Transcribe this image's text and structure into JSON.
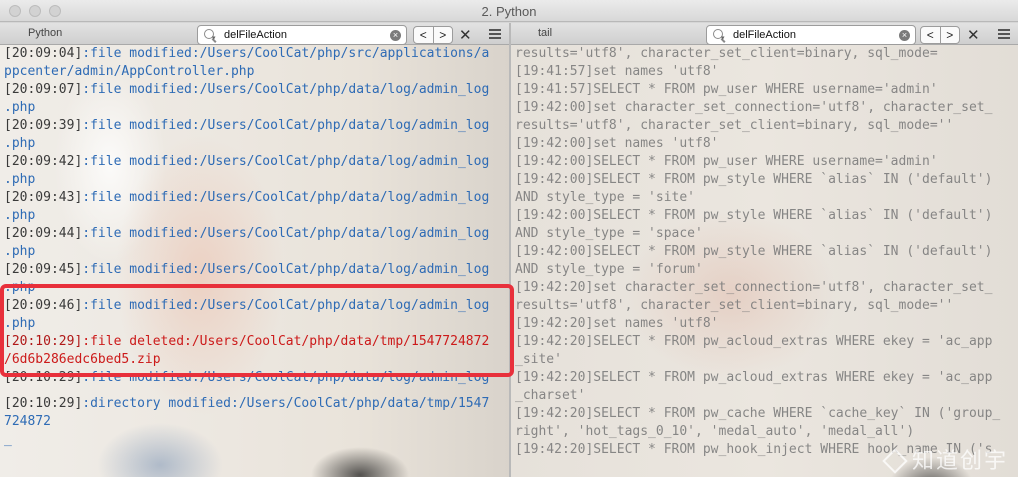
{
  "window": {
    "title": "2. Python"
  },
  "left_pane": {
    "tab_label": "Python",
    "find": {
      "value": "delFileAction",
      "clear": "×",
      "prev": "<",
      "next": ">",
      "close": "✕"
    },
    "lines": [
      {
        "ts": "[20:09:04]",
        "text": ":file modified:/Users/CoolCat/php/src/applications/a"
      },
      {
        "ts": "",
        "text": "ppcenter/admin/AppController.php"
      },
      {
        "ts": "[20:09:07]",
        "text": ":file modified:/Users/CoolCat/php/data/log/admin_log"
      },
      {
        "ts": "",
        "text": ".php"
      },
      {
        "ts": "[20:09:39]",
        "text": ":file modified:/Users/CoolCat/php/data/log/admin_log"
      },
      {
        "ts": "",
        "text": ".php"
      },
      {
        "ts": "[20:09:42]",
        "text": ":file modified:/Users/CoolCat/php/data/log/admin_log"
      },
      {
        "ts": "",
        "text": ".php"
      },
      {
        "ts": "[20:09:43]",
        "text": ":file modified:/Users/CoolCat/php/data/log/admin_log"
      },
      {
        "ts": "",
        "text": ".php"
      },
      {
        "ts": "[20:09:44]",
        "text": ":file modified:/Users/CoolCat/php/data/log/admin_log"
      },
      {
        "ts": "",
        "text": ".php"
      },
      {
        "ts": "[20:09:45]",
        "text": ":file modified:/Users/CoolCat/php/data/log/admin_log"
      },
      {
        "ts": "",
        "text": ".php"
      },
      {
        "ts": "[20:09:46]",
        "text": ":file modified:/Users/CoolCat/php/data/log/admin_log"
      },
      {
        "ts": "",
        "text": ".php"
      },
      {
        "ts": "[20:10:29]",
        "text": ":file deleted:/Users/CoolCat/php/data/tmp/1547724872",
        "red": true
      },
      {
        "ts": "",
        "text": "/6d6b286edc6bed5.zip",
        "red": true
      },
      {
        "ts": "[20:10:29]",
        "text": ":file modified:/Users/CoolCat/php/data/log/admin_log"
      },
      {
        "gap": true
      },
      {
        "ts": "[20:10:29]",
        "text": ":directory modified:/Users/CoolCat/php/data/tmp/1547"
      },
      {
        "ts": "",
        "text": "724872"
      },
      {
        "ts": "",
        "text": "_"
      }
    ]
  },
  "right_pane": {
    "tab_label": "tail",
    "find": {
      "value": "delFileAction",
      "clear": "×",
      "prev": "<",
      "next": ">",
      "close": "✕"
    },
    "lines": [
      "results='utf8', character_set_client=binary, sql_mode=",
      "[19:41:57]set names 'utf8'",
      "[19:41:57]SELECT * FROM pw_user WHERE username='admin'",
      "[19:42:00]set character_set_connection='utf8', character_set_",
      "results='utf8', character_set_client=binary, sql_mode=''",
      "[19:42:00]set names 'utf8'",
      "[19:42:00]SELECT * FROM pw_user WHERE username='admin'",
      "[19:42:00]SELECT * FROM pw_style WHERE `alias` IN ('default')",
      "AND style_type = 'site'",
      "[19:42:00]SELECT * FROM pw_style WHERE `alias` IN ('default')",
      "AND style_type = 'space'",
      "[19:42:00]SELECT * FROM pw_style WHERE `alias` IN ('default')",
      "AND style_type = 'forum'",
      "[19:42:20]set character_set_connection='utf8', character_set_",
      "results='utf8', character_set_client=binary, sql_mode=''",
      "[19:42:20]set names 'utf8'",
      "[19:42:20]SELECT * FROM pw_acloud_extras WHERE ekey = 'ac_app",
      "_site'",
      "[19:42:20]SELECT * FROM pw_acloud_extras WHERE ekey = 'ac_app",
      "_charset'",
      "[19:42:20]SELECT * FROM pw_cache WHERE `cache_key` IN ('group_",
      "right', 'hot_tags_0_10', 'medal_auto', 'medal_all')",
      "[19:42:20]SELECT * FROM pw_hook_inject WHERE hook_name IN ('s"
    ]
  },
  "watermark": "知道创宇",
  "colors": {
    "highlight": "#e8303b",
    "modified": "#2e6bb5",
    "deleted": "#cc1a1a"
  }
}
